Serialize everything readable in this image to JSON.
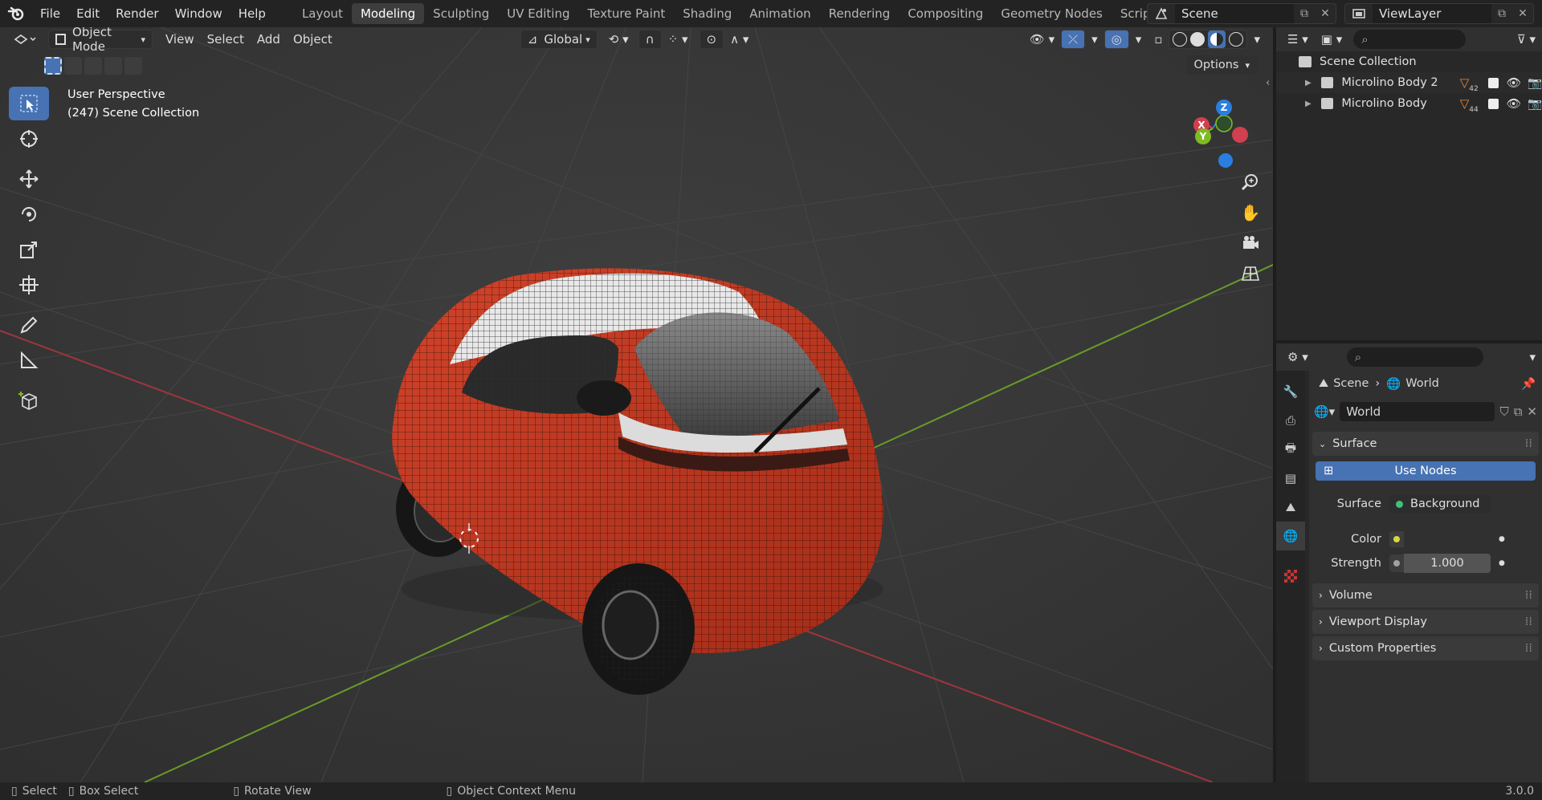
{
  "topbar": {
    "menu": [
      "File",
      "Edit",
      "Render",
      "Window",
      "Help"
    ],
    "workspaces": [
      "Layout",
      "Modeling",
      "Sculpting",
      "UV Editing",
      "Texture Paint",
      "Shading",
      "Animation",
      "Rendering",
      "Compositing",
      "Geometry Nodes",
      "Scripting"
    ],
    "active_workspace": "Modeling",
    "scene_name": "Scene",
    "view_layer": "ViewLayer"
  },
  "viewport": {
    "mode": "Object Mode",
    "menus": [
      "View",
      "Select",
      "Add",
      "Object"
    ],
    "orientation": "Global",
    "options_label": "Options",
    "perspective_label": "User Perspective",
    "collection_label": "(247) Scene Collection",
    "gizmo": {
      "z": "Z",
      "x": "X",
      "y": "Y"
    }
  },
  "outliner": {
    "root": "Scene Collection",
    "items": [
      {
        "name": "Microlino Body 2",
        "count": "42"
      },
      {
        "name": "Microlino Body",
        "count": "44"
      }
    ]
  },
  "properties": {
    "breadcrumb_scene": "Scene",
    "breadcrumb_world": "World",
    "world_name": "World",
    "surface_panel": "Surface",
    "use_nodes_label": "Use Nodes",
    "surface_label": "Surface",
    "surface_value": "Background",
    "color_label": "Color",
    "strength_label": "Strength",
    "strength_value": "1.000",
    "panels": [
      "Volume",
      "Viewport Display",
      "Custom Properties"
    ]
  },
  "statusbar": {
    "select": "Select",
    "box_select": "Box Select",
    "rotate_view": "Rotate View",
    "context_menu": "Object Context Menu",
    "version": "3.0.0"
  },
  "colors": {
    "accent": "#4772b3",
    "car_body": "#c23a22",
    "x_axis": "#d0404f",
    "y_axis": "#7fba23",
    "z_axis": "#2a7ee0"
  }
}
